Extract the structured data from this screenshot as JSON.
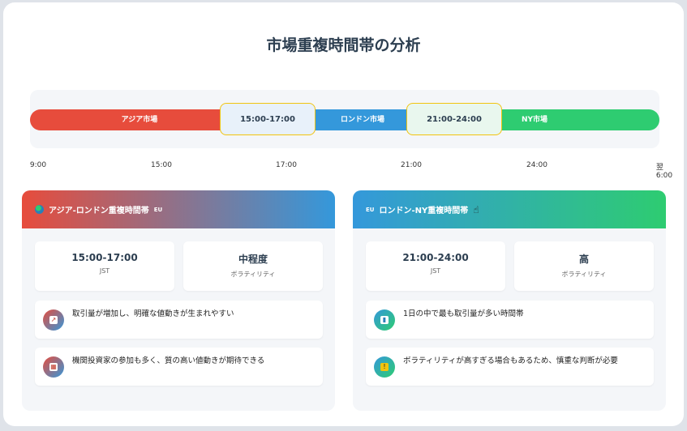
{
  "title": "市場重複時間帯の分析",
  "timeline": {
    "asia_label": "アジア市場",
    "london_label": "ロンドン市場",
    "ny_label": "NY市場",
    "overlap1": "15:00-17:00",
    "overlap2": "21:00-24:00",
    "ticks": [
      "9:00",
      "15:00",
      "17:00",
      "21:00",
      "24:00",
      "翌6:00"
    ]
  },
  "cards": [
    {
      "title": "アジア-ロンドン重複時間帯",
      "badge": "EU",
      "time": "15:00-17:00",
      "time_unit": "JST",
      "volatility": "中程度",
      "volatility_label": "ボラティリティ",
      "features": [
        {
          "icon": "chart-icon",
          "text": "取引量が増加し、明確な値動きが生まれやすい"
        },
        {
          "icon": "building-icon",
          "text": "機関投資家の参加も多く、質の高い値動きが期待できる"
        }
      ]
    },
    {
      "title": "ロンドン-NY重複時間帯",
      "badge": "EU",
      "time": "21:00-24:00",
      "time_unit": "JST",
      "volatility": "高",
      "volatility_label": "ボラティリティ",
      "features": [
        {
          "icon": "bar-chart-icon",
          "text": "1日の中で最も取引量が多い時間帯"
        },
        {
          "icon": "warning-icon",
          "text": "ボラティリティが高すぎる場合もあるため、慎重な判断が必要"
        }
      ]
    }
  ],
  "colors": {
    "asia": "#e74c3c",
    "london": "#3498db",
    "ny": "#2ecc71",
    "overlap_border": "#f1c40f"
  }
}
